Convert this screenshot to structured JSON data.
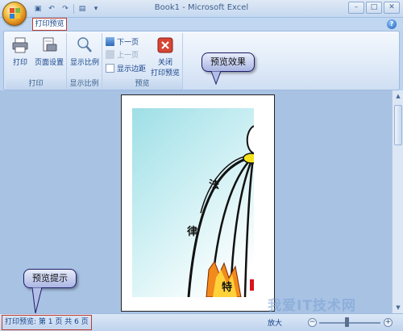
{
  "window": {
    "title": "Book1 - Microsoft Excel",
    "controls": [
      "–",
      "□",
      "✕"
    ]
  },
  "ribbon": {
    "active_tab": "打印预览",
    "groups": {
      "print": {
        "label": "打印",
        "print_button": "打印",
        "page_setup_button": "页面设置"
      },
      "zoom": {
        "label": "显示比例",
        "zoom_button": "显示比例"
      },
      "preview": {
        "label": "预览",
        "next_page": "下一页",
        "prev_page": "上一页",
        "show_margins": "显示边距",
        "close_line1": "关闭",
        "close_line2": "打印预览"
      }
    }
  },
  "preview_content": {
    "char_1": "法",
    "char_2": "律",
    "char_3": "特"
  },
  "callouts": {
    "preview_effect": "预览效果",
    "preview_tip": "预览提示"
  },
  "status_bar": {
    "text": "打印预览: 第 1 页 共 6 页",
    "zoom_label": "放大",
    "zoom_minus": "−",
    "zoom_plus": "+"
  },
  "watermark": "我爱IT技术网",
  "colors": {
    "ribbon_bg": "#dfeaf8",
    "highlight_border": "#c0392b",
    "workspace": "#a8c2e4",
    "text": "#15428b"
  }
}
